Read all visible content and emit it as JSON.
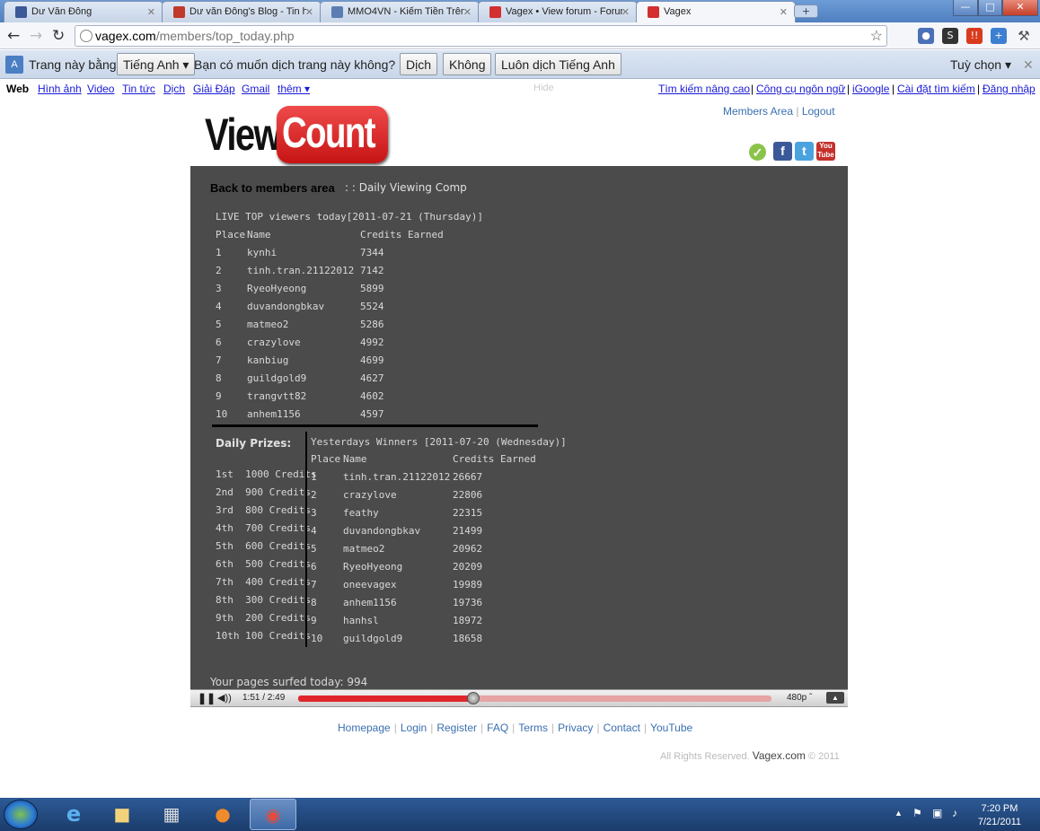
{
  "browser": {
    "tabs": [
      {
        "label": "Dư Văn Đông",
        "icon": "facebook-icon",
        "color": "#3b5998"
      },
      {
        "label": "Dư văn Đông's Blog - Tin h",
        "icon": "blog-icon",
        "color": "#c0392b"
      },
      {
        "label": "MMO4VN - Kiếm Tiền Trên",
        "icon": "forum-icon",
        "color": "#5b7db3"
      },
      {
        "label": "Vagex • View forum - Forur",
        "icon": "youtube-icon",
        "color": "#d32f2f"
      },
      {
        "label": "Vagex",
        "icon": "youtube-icon",
        "color": "#d32f2f"
      }
    ],
    "url_domain": "vagex.com",
    "url_path": "/members/top_today.php",
    "translate": {
      "prompt_prefix": "Trang này bằng",
      "language": "Tiếng Anh",
      "question": "Bạn có muốn dịch trang này không?",
      "translate_btn": "Dịch",
      "no_btn": "Không",
      "always_btn": "Luôn dịch Tiếng Anh",
      "options": "Tuỳ chọn"
    },
    "gbar": {
      "left": [
        "Hình ảnh",
        "Video",
        "Tin tức",
        "Dịch",
        "Giải Đáp",
        "Gmail"
      ],
      "web": "Web",
      "more": "thêm ▾",
      "hide": "Hide",
      "right": [
        "Tìm kiếm nâng cao",
        "Công cụ ngôn ngữ",
        "iGoogle",
        "Cài đặt tìm kiếm",
        "Đăng nhập"
      ]
    }
  },
  "site": {
    "logo_view": "View",
    "logo_count": "Count",
    "members_area": "Members Area",
    "logout": "Logout",
    "back_link": "Back to members area",
    "crumb": ": : Daily Viewing Comp",
    "live_title": "LIVE TOP viewers today[2011-07-21 (Thursday)]",
    "headers": {
      "place": "Place",
      "name": "Name",
      "credits": "Credits Earned"
    },
    "today": [
      {
        "place": "1",
        "name": "kynhi",
        "credits": "7344"
      },
      {
        "place": "2",
        "name": "tinh.tran.21122012",
        "credits": "7142"
      },
      {
        "place": "3",
        "name": "RyeoHyeong",
        "credits": "5899"
      },
      {
        "place": "4",
        "name": "duvandongbkav",
        "credits": "5524"
      },
      {
        "place": "5",
        "name": "matmeo2",
        "credits": "5286"
      },
      {
        "place": "6",
        "name": "crazylove",
        "credits": "4992"
      },
      {
        "place": "7",
        "name": "kanbiug",
        "credits": "4699"
      },
      {
        "place": "8",
        "name": "guildgold9",
        "credits": "4627"
      },
      {
        "place": "9",
        "name": "trangvtt82",
        "credits": "4602"
      },
      {
        "place": "10",
        "name": "anhem1156",
        "credits": "4597"
      }
    ],
    "prizes_title": "Daily Prizes:",
    "prizes": [
      "1st  1000 Credits",
      "2nd  900 Credits",
      "3rd  800 Credits",
      "4th  700 Credits",
      "5th  600 Credits",
      "6th  500 Credits",
      "7th  400 Credits",
      "8th  300 Credits",
      "9th  200 Credits",
      "10th 100 Credits"
    ],
    "yesterday_title": "Yesterdays Winners [2011-07-20 (Wednesday)]",
    "yesterday": [
      {
        "place": "1",
        "name": "tinh.tran.21122012",
        "credits": "26667"
      },
      {
        "place": "2",
        "name": "crazylove",
        "credits": "22806"
      },
      {
        "place": "3",
        "name": "feathy",
        "credits": "22315"
      },
      {
        "place": "4",
        "name": "duvandongbkav",
        "credits": "21499"
      },
      {
        "place": "5",
        "name": "matmeo2",
        "credits": "20962"
      },
      {
        "place": "6",
        "name": "RyeoHyeong",
        "credits": "20209"
      },
      {
        "place": "7",
        "name": "oneevagex",
        "credits": "19989"
      },
      {
        "place": "8",
        "name": "anhem1156",
        "credits": "19736"
      },
      {
        "place": "9",
        "name": "hanhsl",
        "credits": "18972"
      },
      {
        "place": "10",
        "name": "guildgold9",
        "credits": "18658"
      }
    ],
    "surfed": "Your pages surfed today: 994",
    "player": {
      "time": "1:51 / 2:49",
      "quality": "480p",
      "progress": 0.37
    },
    "footer_links": [
      "Homepage",
      "Login",
      "Register",
      "FAQ",
      "Terms",
      "Privacy",
      "Contact",
      "YouTube"
    ],
    "copyright_prefix": "All Rights Reserved.",
    "copyright_brand": "Vagex.com",
    "copyright_suffix": "© 2011"
  },
  "taskbar": {
    "time": "7:20 PM",
    "date": "7/21/2011"
  }
}
